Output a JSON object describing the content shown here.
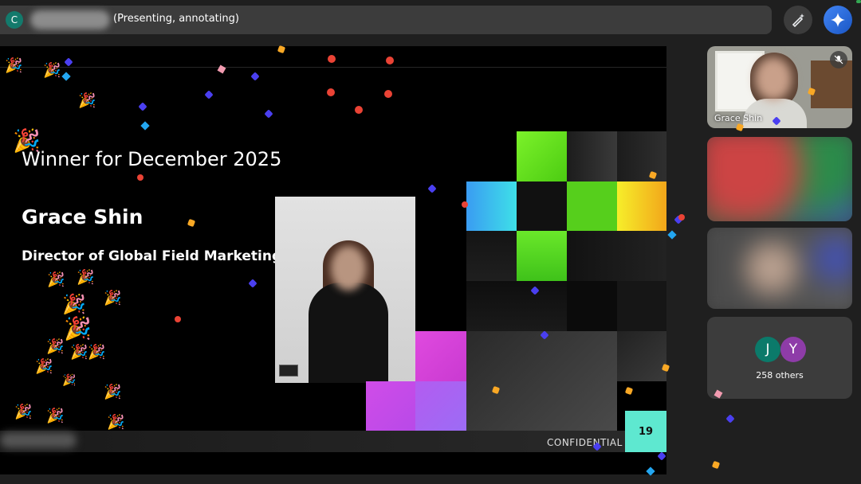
{
  "top_bar": {
    "presenter_initial": "C",
    "presenting_status": "(Presenting, annotating)"
  },
  "slide": {
    "title": "Winner for December 2025",
    "name": "Grace Shin",
    "role": "Director of Global Field Marketing",
    "footer_label": "CONFIDENTIAL",
    "page_number": "19"
  },
  "participants": {
    "tile1_name": "Grace Shin",
    "avatars": [
      "J",
      "Y"
    ],
    "others_label": "258 others"
  },
  "icons": {
    "annotate": "pen-sparkle-icon",
    "gemini": "gemini-sparkle-icon",
    "mute": "mic-off-icon"
  },
  "colors": {
    "bar_bg": "#3c3c3c",
    "slide_bg": "#000000",
    "accent_teal": "#5ee8d0",
    "green_tile": "#56d71f",
    "yellow_tile": "#f4d21a",
    "cyan_tile": "#34c6f2",
    "magenta_tile": "#d84fd8"
  }
}
